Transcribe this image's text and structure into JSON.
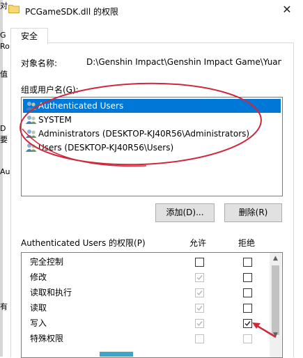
{
  "window": {
    "title": "PCGameSDK.dll 的权限",
    "close_glyph": "✕",
    "edge_fragments": [
      "对",
      "G",
      "Ro",
      "值",
      "D",
      "要",
      "Au",
      "有"
    ]
  },
  "tabs": [
    {
      "label": "安全"
    }
  ],
  "object": {
    "label": "对象名称:",
    "value": "D:\\Genshin Impact\\Genshin Impact Game\\YuanS"
  },
  "groups": {
    "label": "组或用户名(G):",
    "items": [
      {
        "label": "Authenticated Users",
        "selected": true
      },
      {
        "label": "SYSTEM",
        "selected": false
      },
      {
        "label": "Administrators (DESKTOP-KJ40R56\\Administrators)",
        "selected": false
      },
      {
        "label": "Users (DESKTOP-KJ40R56\\Users)",
        "selected": false
      }
    ]
  },
  "buttons": {
    "add": "添加(D)...",
    "remove": "删除(R)"
  },
  "permissions": {
    "header": "Authenticated Users 的权限(P)",
    "allow_label": "允许",
    "deny_label": "拒绝",
    "rows": [
      {
        "name": "完全控制",
        "allow": false,
        "allow_disabled": false,
        "deny": false
      },
      {
        "name": "修改",
        "allow": true,
        "allow_disabled": true,
        "deny": false
      },
      {
        "name": "读取和执行",
        "allow": true,
        "allow_disabled": true,
        "deny": false
      },
      {
        "name": "读取",
        "allow": true,
        "allow_disabled": true,
        "deny": false
      },
      {
        "name": "写入",
        "allow": true,
        "allow_disabled": true,
        "deny": true
      },
      {
        "name": "特殊权限",
        "allow": false,
        "allow_disabled": true,
        "deny": false
      }
    ]
  },
  "annotation_color": "#d0283a",
  "accent": "#0078d7"
}
